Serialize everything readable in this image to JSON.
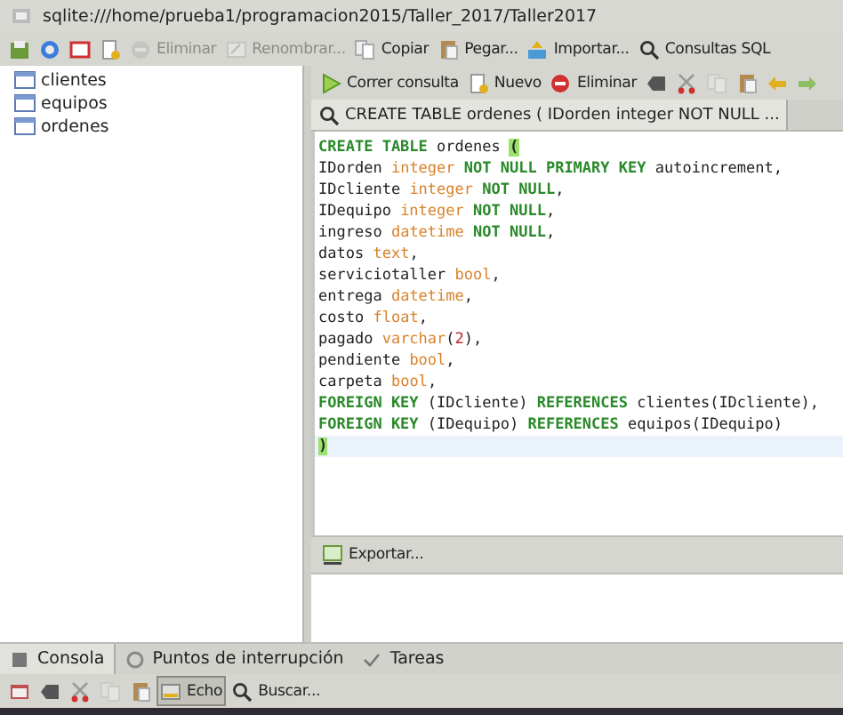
{
  "window": {
    "title": "sqlite:///home/prueba1/programacion2015/Taller_2017/Taller2017"
  },
  "toolbar": [
    {
      "disabled": false
    },
    {
      "disabled": false
    },
    {
      "disabled": false
    },
    {
      "disabled": false
    },
    {
      "label": "Eliminar",
      "disabled": true
    },
    {
      "label": "Renombrar...",
      "disabled": true
    },
    {
      "label": "Copiar",
      "disabled": false
    },
    {
      "label": "Pegar...",
      "disabled": false
    },
    {
      "label": "Importar...",
      "disabled": false
    },
    {
      "label": "Consultas SQL",
      "disabled": false
    }
  ],
  "tables": [
    {
      "label": "clientes",
      "selected": false
    },
    {
      "label": "equipos",
      "selected": false
    },
    {
      "label": "ordenes",
      "selected": false
    }
  ],
  "query_toolbar": [
    {
      "label": "Correr consulta",
      "disabled": false
    },
    {
      "label": "Nuevo",
      "disabled": false
    },
    {
      "label": "Eliminar",
      "disabled": false
    },
    {
      "disabled": false
    },
    {
      "disabled": false
    },
    {
      "disabled": true
    },
    {
      "disabled": false
    },
    {
      "disabled": false
    },
    {
      "disabled": false
    }
  ],
  "query_tabs": [
    {
      "label": "CREATE TABLE ordenes ( IDorden integer NOT NULL ...",
      "selected": true
    }
  ],
  "editor": {
    "lines": [
      {
        "current": false,
        "tokens": [
          {
            "kind": "keyword",
            "t": "CREATE TABLE"
          },
          {
            "kind": "plain",
            "t": " ordenes "
          },
          {
            "kind": "match",
            "t": "("
          }
        ]
      },
      {
        "current": false,
        "tokens": [
          {
            "kind": "plain",
            "t": "IDorden "
          },
          {
            "kind": "type",
            "t": "integer"
          },
          {
            "kind": "keyword",
            "t": " NOT NULL PRIMARY KEY"
          },
          {
            "kind": "plain",
            "t": " autoincrement,"
          }
        ]
      },
      {
        "current": false,
        "tokens": [
          {
            "kind": "plain",
            "t": "IDcliente "
          },
          {
            "kind": "type",
            "t": "integer"
          },
          {
            "kind": "keyword",
            "t": " NOT NULL"
          },
          {
            "kind": "plain",
            "t": ","
          }
        ]
      },
      {
        "current": false,
        "tokens": [
          {
            "kind": "plain",
            "t": "IDequipo "
          },
          {
            "kind": "type",
            "t": "integer"
          },
          {
            "kind": "keyword",
            "t": " NOT NULL"
          },
          {
            "kind": "plain",
            "t": ","
          }
        ]
      },
      {
        "current": false,
        "tokens": [
          {
            "kind": "plain",
            "t": "ingreso "
          },
          {
            "kind": "type",
            "t": "datetime"
          },
          {
            "kind": "keyword",
            "t": " NOT NULL"
          },
          {
            "kind": "plain",
            "t": ","
          }
        ]
      },
      {
        "current": false,
        "tokens": [
          {
            "kind": "plain",
            "t": "datos "
          },
          {
            "kind": "type",
            "t": "text"
          },
          {
            "kind": "plain",
            "t": ","
          }
        ]
      },
      {
        "current": false,
        "tokens": [
          {
            "kind": "plain",
            "t": "serviciotaller "
          },
          {
            "kind": "type",
            "t": "bool"
          },
          {
            "kind": "plain",
            "t": ","
          }
        ]
      },
      {
        "current": false,
        "tokens": [
          {
            "kind": "plain",
            "t": "entrega "
          },
          {
            "kind": "type",
            "t": "datetime"
          },
          {
            "kind": "plain",
            "t": ","
          }
        ]
      },
      {
        "current": false,
        "tokens": [
          {
            "kind": "plain",
            "t": "costo "
          },
          {
            "kind": "type",
            "t": "float"
          },
          {
            "kind": "plain",
            "t": ","
          }
        ]
      },
      {
        "current": false,
        "tokens": [
          {
            "kind": "plain",
            "t": "pagado "
          },
          {
            "kind": "type",
            "t": "varchar"
          },
          {
            "kind": "plain",
            "t": "("
          },
          {
            "kind": "number",
            "t": "2"
          },
          {
            "kind": "plain",
            "t": "),"
          }
        ]
      },
      {
        "current": false,
        "tokens": [
          {
            "kind": "plain",
            "t": "pendiente "
          },
          {
            "kind": "type",
            "t": "bool"
          },
          {
            "kind": "plain",
            "t": ","
          }
        ]
      },
      {
        "current": false,
        "tokens": [
          {
            "kind": "plain",
            "t": "carpeta "
          },
          {
            "kind": "type",
            "t": "bool"
          },
          {
            "kind": "plain",
            "t": ","
          }
        ]
      },
      {
        "current": false,
        "tokens": [
          {
            "kind": "keyword",
            "t": "FOREIGN KEY"
          },
          {
            "kind": "plain",
            "t": " (IDcliente) "
          },
          {
            "kind": "keyword",
            "t": "REFERENCES"
          },
          {
            "kind": "plain",
            "t": " clientes(IDcliente),"
          }
        ]
      },
      {
        "current": false,
        "tokens": [
          {
            "kind": "keyword",
            "t": "FOREIGN KEY"
          },
          {
            "kind": "plain",
            "t": " (IDequipo) "
          },
          {
            "kind": "keyword",
            "t": "REFERENCES"
          },
          {
            "kind": "plain",
            "t": " equipos(IDequipo)"
          }
        ]
      },
      {
        "current": true,
        "tokens": [
          {
            "kind": "match",
            "t": ")"
          }
        ]
      }
    ]
  },
  "export_button": "Exportar...",
  "bottom_tabs": [
    {
      "label": "Consola",
      "selected": true
    },
    {
      "label": "Puntos de interrupción",
      "selected": false
    },
    {
      "label": "Tareas",
      "selected": false
    }
  ],
  "bottom_toolbar": [
    {
      "disabled": false,
      "on": false
    },
    {
      "disabled": false,
      "on": false
    },
    {
      "disabled": false,
      "on": false
    },
    {
      "disabled": true,
      "on": false
    },
    {
      "disabled": false,
      "on": false
    },
    {
      "label": "Echo",
      "disabled": false,
      "on": true
    },
    {
      "label": "Buscar...",
      "disabled": false,
      "on": false
    }
  ]
}
